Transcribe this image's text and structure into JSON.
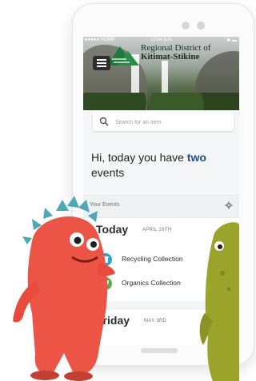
{
  "status": {
    "carrier": "HOME",
    "time": "12:54 p.m."
  },
  "header": {
    "logo_line1": "Regional District of",
    "logo_line2": "Kitimat-Stikine"
  },
  "search": {
    "placeholder": "Search for an item"
  },
  "greeting": {
    "prefix": "Hi, today you have ",
    "count": "two",
    "suffix": " events"
  },
  "events": {
    "label": "Your Events",
    "days": [
      {
        "day": "Today",
        "date": "APRIL 26TH",
        "items": [
          {
            "label": "Recycling Collection",
            "icon": "recycle-bin-icon"
          },
          {
            "label": "Organics Collection",
            "icon": "organics-leaf-icon"
          }
        ]
      },
      {
        "day": "Friday",
        "date": "MAY 3RD",
        "items": []
      }
    ]
  },
  "colors": {
    "accent": "#1e4f8a",
    "recycling": "#2aa4d8",
    "organics": "#5ca74a",
    "monster_red": "#ec5546",
    "monster_green": "#9aa32a"
  }
}
